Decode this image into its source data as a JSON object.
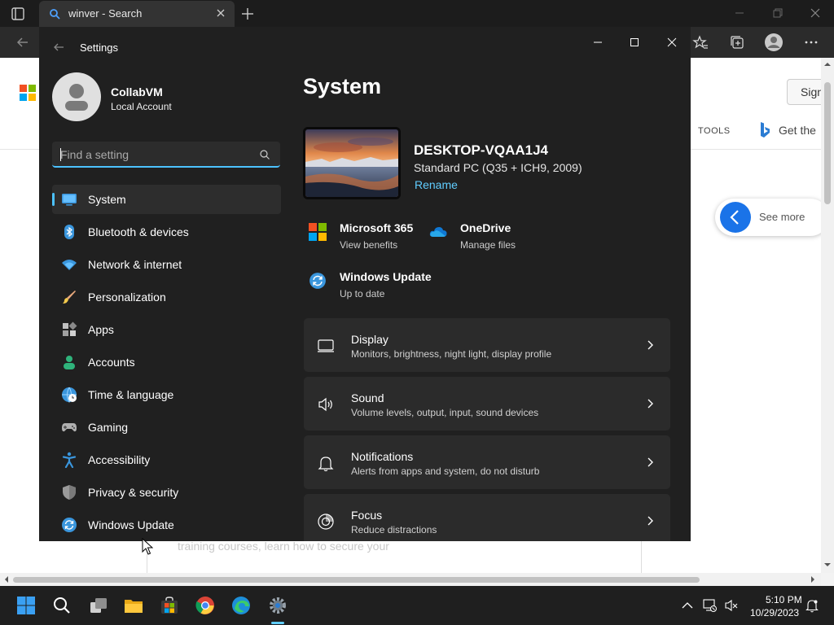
{
  "browser": {
    "tab_title": "winver - Search"
  },
  "webpage": {
    "signin_label": "Sign",
    "tools_label": "TOOLS",
    "bing_promo": "Get the",
    "see_more_label": "See more",
    "card_text": "training courses, learn how to secure your"
  },
  "settings": {
    "window_title": "Settings",
    "user": {
      "name": "CollabVM",
      "account_type": "Local Account"
    },
    "search": {
      "placeholder": "Find a setting",
      "value": ""
    },
    "nav": [
      {
        "label": "System",
        "icon": "system-icon",
        "selected": true
      },
      {
        "label": "Bluetooth & devices",
        "icon": "bluetooth-icon"
      },
      {
        "label": "Network & internet",
        "icon": "wifi-icon"
      },
      {
        "label": "Personalization",
        "icon": "paintbrush-icon"
      },
      {
        "label": "Apps",
        "icon": "apps-icon"
      },
      {
        "label": "Accounts",
        "icon": "person-icon"
      },
      {
        "label": "Time & language",
        "icon": "globe-clock-icon"
      },
      {
        "label": "Gaming",
        "icon": "gamepad-icon"
      },
      {
        "label": "Accessibility",
        "icon": "accessibility-icon"
      },
      {
        "label": "Privacy & security",
        "icon": "shield-icon"
      },
      {
        "label": "Windows Update",
        "icon": "windows-update-icon"
      }
    ],
    "main": {
      "title": "System",
      "device": {
        "name": "DESKTOP-VQAA1J4",
        "model": "Standard PC (Q35 + ICH9, 2009)",
        "rename_label": "Rename"
      },
      "tiles": [
        {
          "title": "Microsoft 365",
          "subtitle": "View benefits",
          "icon": "microsoft-365-icon"
        },
        {
          "title": "OneDrive",
          "subtitle": "Manage files",
          "icon": "onedrive-icon"
        },
        {
          "title": "Windows Update",
          "subtitle": "Up to date",
          "icon": "windows-update-icon"
        }
      ],
      "cards": [
        {
          "title": "Display",
          "subtitle": "Monitors, brightness, night light, display profile",
          "icon": "display-icon"
        },
        {
          "title": "Sound",
          "subtitle": "Volume levels, output, input, sound devices",
          "icon": "speaker-icon"
        },
        {
          "title": "Notifications",
          "subtitle": "Alerts from apps and system, do not disturb",
          "icon": "bell-icon"
        },
        {
          "title": "Focus",
          "subtitle": "Reduce distractions",
          "icon": "focus-icon"
        }
      ]
    }
  },
  "taskbar": {
    "time": "5:10 PM",
    "date": "10/29/2023"
  },
  "colors": {
    "accent": "#4cc2ff",
    "link": "#60cdff",
    "window_bg": "#202020",
    "card_bg": "#2b2b2b"
  }
}
